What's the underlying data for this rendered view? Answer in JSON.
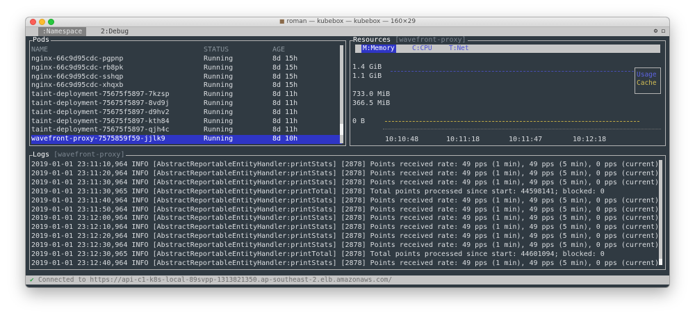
{
  "window": {
    "title": "roman — kubebox — kubebox — 160×29",
    "icon": "home-icon"
  },
  "tabs": [
    {
      "label": ":Namespace",
      "prefix": "1"
    },
    {
      "label": "2:Debug"
    }
  ],
  "tab_controls": "⚙ ◻",
  "pods": {
    "title": "Pods",
    "columns": [
      "NAME",
      "STATUS",
      "AGE"
    ],
    "rows": [
      {
        "name": "nginx-66c9d95cdc-pgpnp",
        "status": "Running",
        "age": "8d 15h"
      },
      {
        "name": "nginx-66c9d95cdc-rb8pk",
        "status": "Running",
        "age": "8d 15h"
      },
      {
        "name": "nginx-66c9d95cdc-sshqp",
        "status": "Running",
        "age": "8d 15h"
      },
      {
        "name": "nginx-66c9d95cdc-xhqxb",
        "status": "Running",
        "age": "8d 15h"
      },
      {
        "name": "taint-deployment-75675f5897-7kzsp",
        "status": "Running",
        "age": "8d 11h"
      },
      {
        "name": "taint-deployment-75675f5897-8vd9j",
        "status": "Running",
        "age": "8d 11h"
      },
      {
        "name": "taint-deployment-75675f5897-d9hv2",
        "status": "Running",
        "age": "8d 11h"
      },
      {
        "name": "taint-deployment-75675f5897-kth84",
        "status": "Running",
        "age": "8d 11h"
      },
      {
        "name": "taint-deployment-75675f5897-qjh4c",
        "status": "Running",
        "age": "8d 11h"
      },
      {
        "name": "wavefront-proxy-7575859f59-jjlk9",
        "status": "Running",
        "age": "8d 10h",
        "selected": true
      }
    ]
  },
  "resources": {
    "title": "Resources",
    "pod": "[wavefront-proxy]",
    "tabs": [
      {
        "label": "M:Memory",
        "active": true
      },
      {
        "label": "C:CPU"
      },
      {
        "label": "T:Net"
      }
    ],
    "y_labels": [
      "1.4 GiB",
      "1.1 GiB",
      "733.0 MiB",
      "366.5 MiB",
      "0 B"
    ],
    "x_labels": [
      "10:10:48",
      "10:11:18",
      "10:11:47",
      "10:12:18"
    ],
    "legend": {
      "usage": "Usage",
      "cache": "Cache"
    },
    "colors": {
      "usage": "#474fb4",
      "cache": "#c2ab45"
    }
  },
  "logs": {
    "title": "Logs",
    "pod": "[wavefront-proxy]",
    "lines": [
      "2019-01-01 23:11:10,964 INFO  [AbstractReportableEntityHandler:printStats] [2878] Points received rate: 49 pps (1 min), 49 pps (5 min), 0 pps (current).",
      "2019-01-01 23:11:20,964 INFO  [AbstractReportableEntityHandler:printStats] [2878] Points received rate: 49 pps (1 min), 49 pps (5 min), 0 pps (current).",
      "2019-01-01 23:11:30,964 INFO  [AbstractReportableEntityHandler:printStats] [2878] Points received rate: 49 pps (1 min), 49 pps (5 min), 0 pps (current).",
      "2019-01-01 23:11:30,965 INFO  [AbstractReportableEntityHandler:printTotal] [2878] Total points processed since start: 44598141; blocked: 0",
      "2019-01-01 23:11:40,964 INFO  [AbstractReportableEntityHandler:printStats] [2878] Points received rate: 49 pps (1 min), 49 pps (5 min), 0 pps (current).",
      "2019-01-01 23:11:50,964 INFO  [AbstractReportableEntityHandler:printStats] [2878] Points received rate: 49 pps (1 min), 49 pps (5 min), 0 pps (current).",
      "2019-01-01 23:12:00,964 INFO  [AbstractReportableEntityHandler:printStats] [2878] Points received rate: 49 pps (1 min), 49 pps (5 min), 0 pps (current).",
      "2019-01-01 23:12:10,964 INFO  [AbstractReportableEntityHandler:printStats] [2878] Points received rate: 49 pps (1 min), 49 pps (5 min), 0 pps (current).",
      "2019-01-01 23:12:20,964 INFO  [AbstractReportableEntityHandler:printStats] [2878] Points received rate: 49 pps (1 min), 49 pps (5 min), 0 pps (current).",
      "2019-01-01 23:12:30,964 INFO  [AbstractReportableEntityHandler:printStats] [2878] Points received rate: 49 pps (1 min), 49 pps (5 min), 0 pps (current).",
      "2019-01-01 23:12:30,965 INFO  [AbstractReportableEntityHandler:printTotal] [2878] Total points processed since start: 44601094; blocked: 0",
      "2019-01-01 23:12:40,964 INFO  [AbstractReportableEntityHandler:printStats] [2878] Points received rate: 49 pps (1 min), 49 pps (5 min), 0 pps (current)."
    ]
  },
  "status": {
    "icon": "check-icon",
    "text": "Connected to https://api-c1-k8s-local-89svpp-1313821350.ap-southeast-2.elb.amazonaws.com/"
  }
}
